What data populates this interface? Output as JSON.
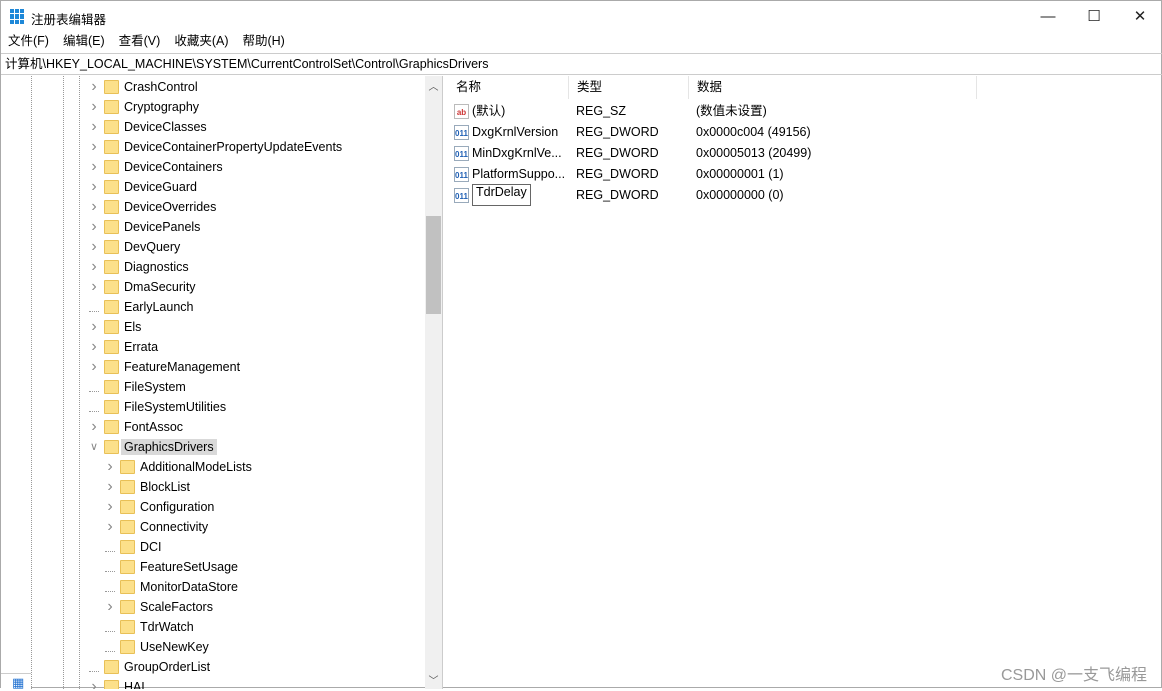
{
  "window": {
    "title": "注册表编辑器",
    "minimize": "—",
    "maximize": "☐",
    "close": "✕"
  },
  "menu": [
    "文件(F)",
    "编辑(E)",
    "查看(V)",
    "收藏夹(A)",
    "帮助(H)"
  ],
  "address": "计算机\\HKEY_LOCAL_MACHINE\\SYSTEM\\CurrentControlSet\\Control\\GraphicsDrivers",
  "tree": [
    {
      "label": "CrashControl",
      "level": 1,
      "expandable": true
    },
    {
      "label": "Cryptography",
      "level": 1,
      "expandable": true
    },
    {
      "label": "DeviceClasses",
      "level": 1,
      "expandable": true
    },
    {
      "label": "DeviceContainerPropertyUpdateEvents",
      "level": 1,
      "expandable": true
    },
    {
      "label": "DeviceContainers",
      "level": 1,
      "expandable": true
    },
    {
      "label": "DeviceGuard",
      "level": 1,
      "expandable": true
    },
    {
      "label": "DeviceOverrides",
      "level": 1,
      "expandable": true
    },
    {
      "label": "DevicePanels",
      "level": 1,
      "expandable": true
    },
    {
      "label": "DevQuery",
      "level": 1,
      "expandable": true
    },
    {
      "label": "Diagnostics",
      "level": 1,
      "expandable": true
    },
    {
      "label": "DmaSecurity",
      "level": 1,
      "expandable": true
    },
    {
      "label": "EarlyLaunch",
      "level": 1,
      "expandable": false
    },
    {
      "label": "Els",
      "level": 1,
      "expandable": true
    },
    {
      "label": "Errata",
      "level": 1,
      "expandable": true
    },
    {
      "label": "FeatureManagement",
      "level": 1,
      "expandable": true
    },
    {
      "label": "FileSystem",
      "level": 1,
      "expandable": false
    },
    {
      "label": "FileSystemUtilities",
      "level": 1,
      "expandable": false
    },
    {
      "label": "FontAssoc",
      "level": 1,
      "expandable": true
    },
    {
      "label": "GraphicsDrivers",
      "level": 1,
      "expandable": true,
      "expanded": true,
      "selected": true
    },
    {
      "label": "AdditionalModeLists",
      "level": 2,
      "expandable": true
    },
    {
      "label": "BlockList",
      "level": 2,
      "expandable": true
    },
    {
      "label": "Configuration",
      "level": 2,
      "expandable": true
    },
    {
      "label": "Connectivity",
      "level": 2,
      "expandable": true
    },
    {
      "label": "DCI",
      "level": 2,
      "expandable": false
    },
    {
      "label": "FeatureSetUsage",
      "level": 2,
      "expandable": false
    },
    {
      "label": "MonitorDataStore",
      "level": 2,
      "expandable": false
    },
    {
      "label": "ScaleFactors",
      "level": 2,
      "expandable": true
    },
    {
      "label": "TdrWatch",
      "level": 2,
      "expandable": false
    },
    {
      "label": "UseNewKey",
      "level": 2,
      "expandable": false
    },
    {
      "label": "GroupOrderList",
      "level": 1,
      "expandable": false
    },
    {
      "label": "HAL",
      "level": 1,
      "expandable": true
    }
  ],
  "list": {
    "headers": {
      "name": "名称",
      "type": "类型",
      "data": "数据"
    },
    "rows": [
      {
        "icon": "string-value-icon",
        "glyph": "ab",
        "name": "(默认)",
        "type": "REG_SZ",
        "data": "(数值未设置)"
      },
      {
        "icon": "binary-value-icon",
        "glyph": "011",
        "name": "DxgKrnlVersion",
        "type": "REG_DWORD",
        "data": "0x0000c004 (49156)"
      },
      {
        "icon": "binary-value-icon",
        "glyph": "011",
        "name": "MinDxgKrnlVe...",
        "type": "REG_DWORD",
        "data": "0x00005013 (20499)"
      },
      {
        "icon": "binary-value-icon",
        "glyph": "011",
        "name": "PlatformSuppo...",
        "type": "REG_DWORD",
        "data": "0x00000001 (1)"
      },
      {
        "icon": "binary-value-icon",
        "glyph": "011",
        "name": "TdrDelay",
        "type": "REG_DWORD",
        "data": "0x00000000 (0)",
        "editing": true
      }
    ]
  },
  "watermark": "CSDN @一支飞编程"
}
